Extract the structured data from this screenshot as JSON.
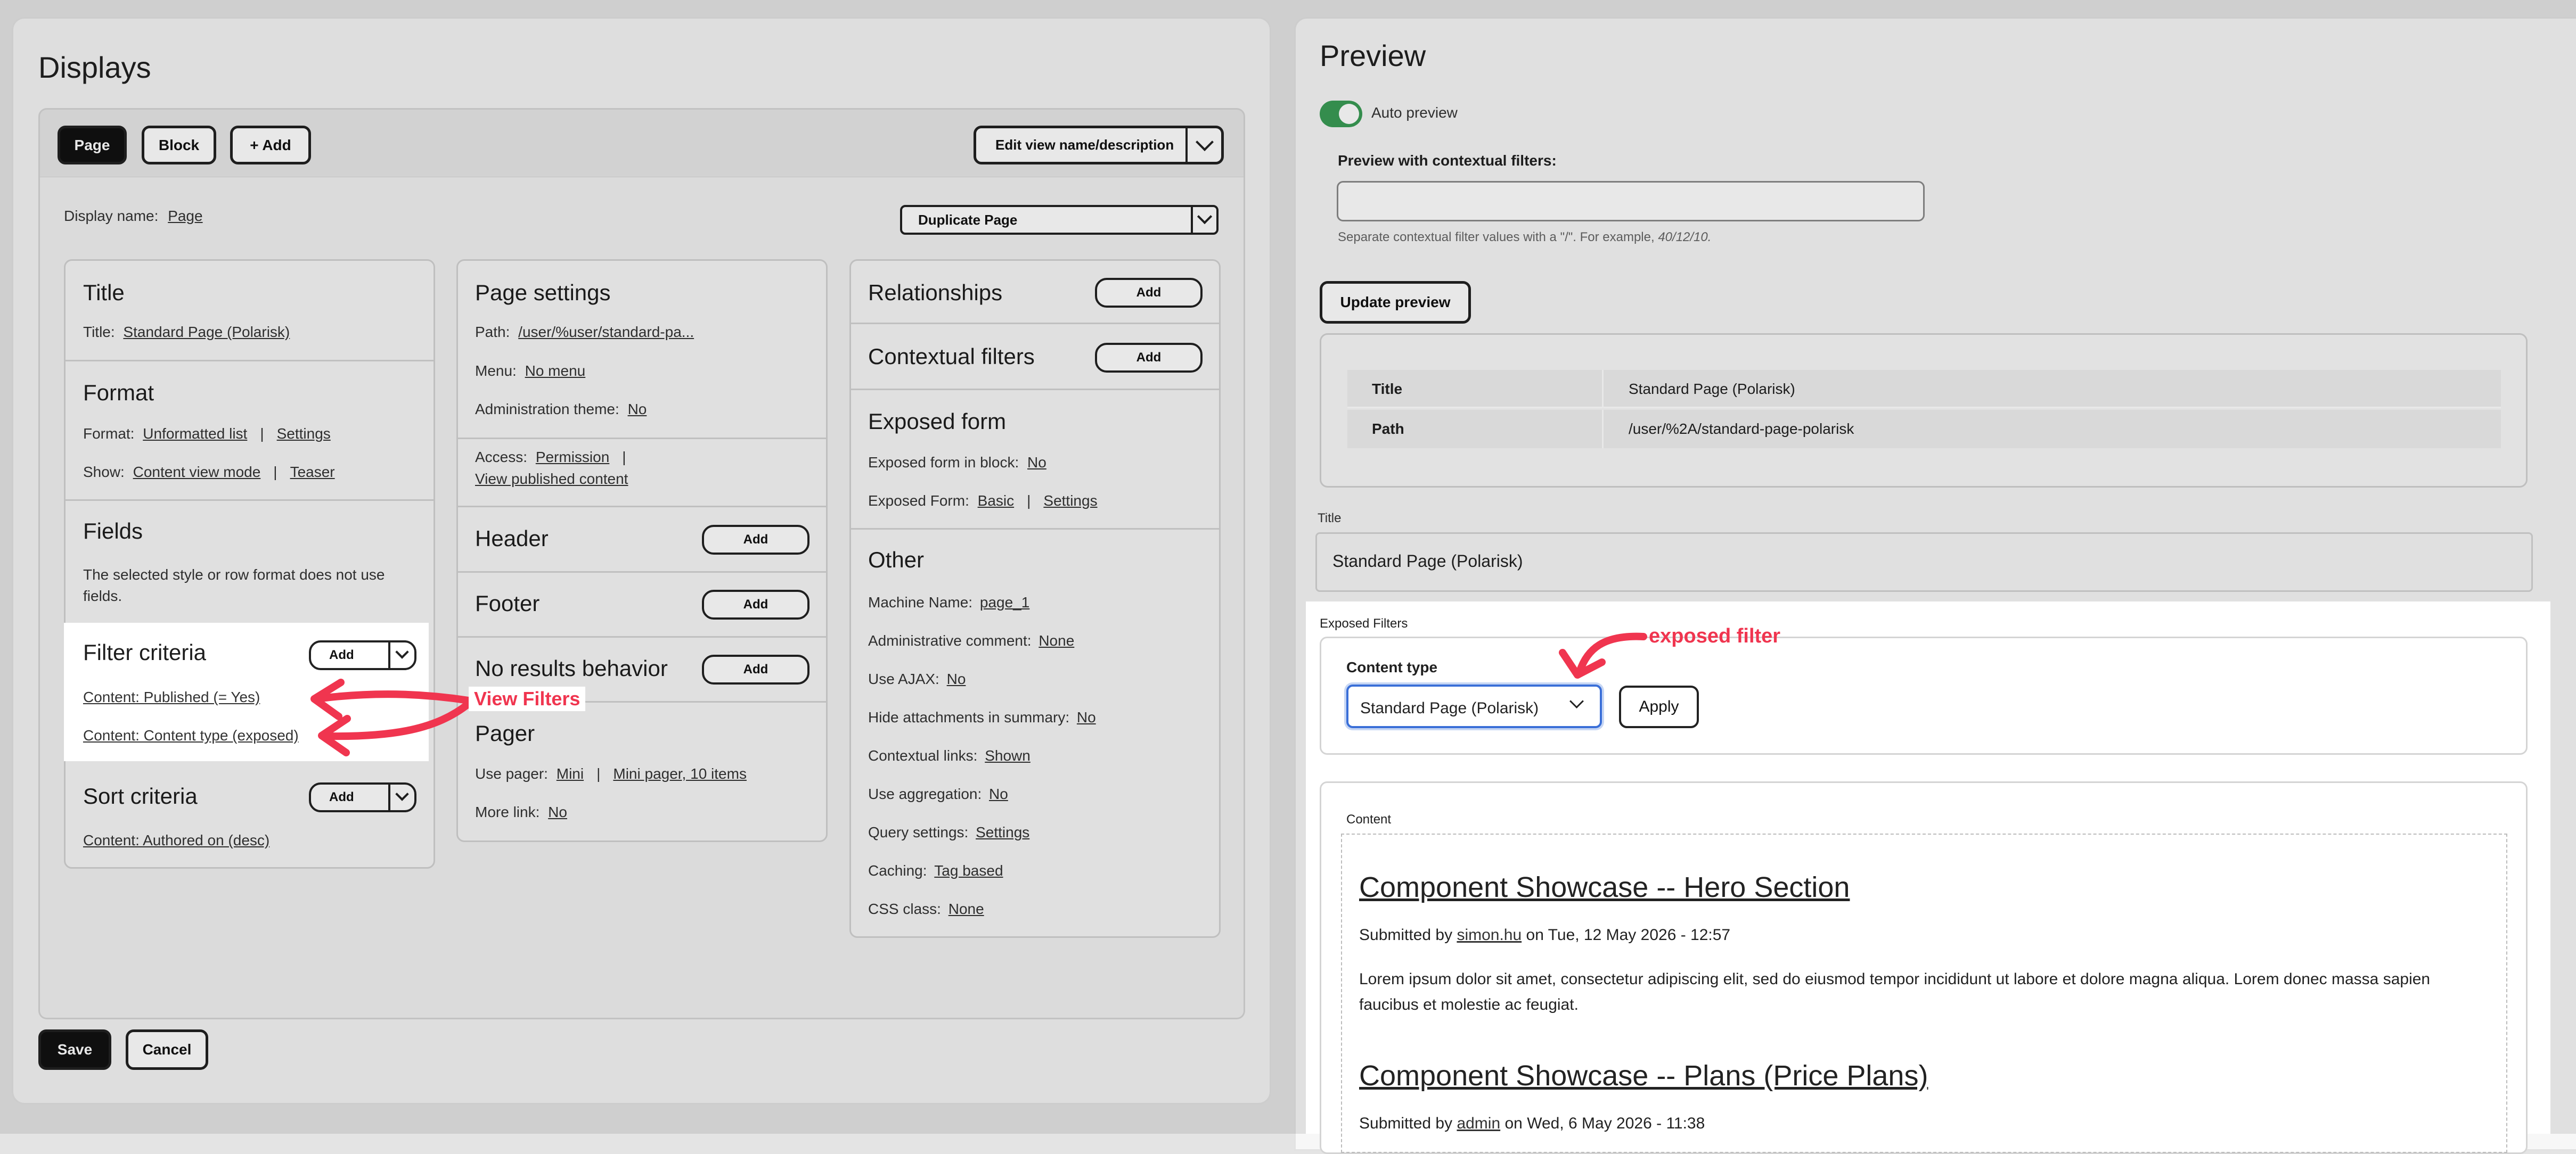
{
  "displays": {
    "heading": "Displays",
    "tabs": {
      "page": "Page",
      "block": "Block",
      "add": "+ Add"
    },
    "edit_button": "Edit view name/description",
    "display_name_label": "Display name:",
    "display_name_value": "Page",
    "duplicate_button": "Duplicate Page"
  },
  "col1": {
    "title": {
      "heading": "Title",
      "label": "Title:",
      "value": "Standard Page (Polarisk)"
    },
    "format": {
      "heading": "Format",
      "format_label": "Format:",
      "format_value": "Unformatted list",
      "format_settings": "Settings",
      "show_label": "Show:",
      "show_value": "Content view mode",
      "show_teaser": "Teaser"
    },
    "fields": {
      "heading": "Fields",
      "note": "The selected style or row format does not use fields."
    },
    "filter": {
      "heading": "Filter criteria",
      "add": "Add",
      "item1": "Content: Published (= Yes)",
      "item2": "Content: Content type (exposed)"
    },
    "sort": {
      "heading": "Sort criteria",
      "add": "Add",
      "item1": "Content: Authored on (desc)"
    }
  },
  "col2": {
    "page_settings": {
      "heading": "Page settings",
      "path_label": "Path:",
      "path_value": "/user/%user/standard-pa...",
      "menu_label": "Menu:",
      "menu_value": "No menu",
      "admin_label": "Administration theme:",
      "admin_value": "No",
      "access_label": "Access:",
      "access_value": "Permission",
      "access_value2": "View published content"
    },
    "header": {
      "heading": "Header",
      "add": "Add"
    },
    "footer": {
      "heading": "Footer",
      "add": "Add"
    },
    "no_results": {
      "heading": "No results behavior",
      "add": "Add"
    },
    "pager": {
      "heading": "Pager",
      "use_label": "Use pager:",
      "use_value": "Mini",
      "use_value2": "Mini pager, 10 items",
      "more_label": "More link:",
      "more_value": "No"
    }
  },
  "col3": {
    "relationships": {
      "heading": "Relationships",
      "add": "Add"
    },
    "contextual": {
      "heading": "Contextual filters",
      "add": "Add"
    },
    "exposed": {
      "heading": "Exposed form",
      "block_label": "Exposed form in block:",
      "block_value": "No",
      "form_label": "Exposed Form:",
      "form_value": "Basic",
      "form_settings": "Settings"
    },
    "other": {
      "heading": "Other",
      "rows": [
        {
          "label": "Machine Name:",
          "value": "page_1"
        },
        {
          "label": "Administrative comment:",
          "value": "None"
        },
        {
          "label": "Use AJAX:",
          "value": "No"
        },
        {
          "label": "Hide attachments in summary:",
          "value": "No"
        },
        {
          "label": "Contextual links:",
          "value": "Shown"
        },
        {
          "label": "Use aggregation:",
          "value": "No"
        },
        {
          "label": "Query settings:",
          "value": "Settings"
        },
        {
          "label": "Caching:",
          "value": "Tag based"
        },
        {
          "label": "CSS class:",
          "value": "None"
        }
      ]
    }
  },
  "actions": {
    "save": "Save",
    "cancel": "Cancel"
  },
  "annotations": {
    "view_filters": "View Filters",
    "exposed_filter": "exposed filter"
  },
  "preview": {
    "heading": "Preview",
    "auto_preview": "Auto preview",
    "contextual_label": "Preview with contextual filters:",
    "contextual_placeholder": "",
    "help_text": "Separate contextual filter values with a \"/\". For example,",
    "help_example": "40/12/10.",
    "update_button": "Update preview",
    "table": [
      {
        "key": "Title",
        "value": "Standard Page (Polarisk)"
      },
      {
        "key": "Path",
        "value": "/user/%2A/standard-page-polarisk"
      }
    ],
    "title_label": "Title",
    "title_value": "Standard Page (Polarisk)",
    "exposed_label": "Exposed Filters",
    "content_type_label": "Content type",
    "content_type_value": "Standard Page (Polarisk)",
    "apply": "Apply",
    "content_label": "Content",
    "items": [
      {
        "title": "Component Showcase -- Hero Section",
        "submitted_prefix": "Submitted by",
        "author": "simon.hu",
        "submitted_suffix": "on Tue, 12 May 2026 - 12:57",
        "body": "Lorem ipsum dolor sit amet, consectetur adipiscing elit, sed do eiusmod tempor incididunt ut labore et dolore magna aliqua. Lorem donec massa sapien faucibus et molestie ac feugiat."
      },
      {
        "title": "Component Showcase -- Plans (Price Plans)",
        "submitted_prefix": "Submitted by",
        "author": "admin",
        "submitted_suffix": "on Wed, 6 May 2026 - 11:38"
      }
    ]
  },
  "colors": {
    "accent_red": "#f0354f",
    "toggle_green": "#3a9b55",
    "focus_blue": "#3a6fd8"
  }
}
